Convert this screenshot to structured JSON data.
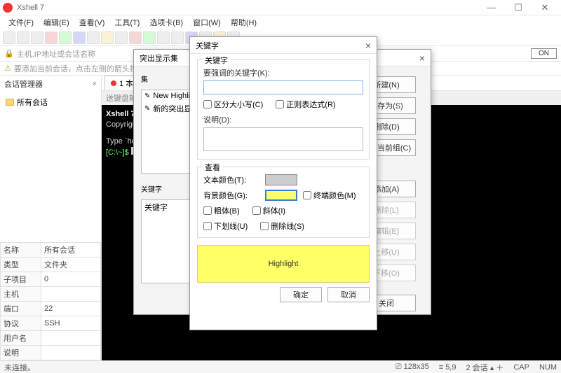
{
  "app": {
    "title": "Xshell 7"
  },
  "menu": [
    "文件(F)",
    "编辑(E)",
    "查看(V)",
    "工具(T)",
    "选项卡(B)",
    "窗口(W)",
    "帮助(H)"
  ],
  "addressbar": {
    "placeholder": "主机,IP地址或会话名称",
    "toggle": "ON"
  },
  "hint": "要添加当前会话，点击左侧的箭头按钮。",
  "session_panel": {
    "title": "会话管理器",
    "root": "所有会话",
    "props": [
      [
        "名称",
        "所有会话"
      ],
      [
        "类型",
        "文件夹"
      ],
      [
        "子项目",
        "0"
      ],
      [
        "主机",
        ""
      ],
      [
        "端口",
        "22"
      ],
      [
        "协议",
        "SSH"
      ],
      [
        "用户名",
        ""
      ],
      [
        "说明",
        ""
      ]
    ]
  },
  "tab": {
    "label": "1 本地"
  },
  "terminal": {
    "banner": "Xshell 7",
    "copyright": "Copyright",
    "typeline": "Type `he",
    "prompt": "[C:\\~]$ "
  },
  "keyboard_hint": "送键盘输入",
  "status": {
    "left": "未连接。",
    "dim": "128x35",
    "pos": "5,9",
    "sessions": "2 会话",
    "cap": "CAP",
    "num": "NUM"
  },
  "dlg_highlight": {
    "title": "突出显示集",
    "group_set": "集",
    "sets": [
      "New Highlight",
      "新的突出显"
    ],
    "group_kw": "关键字",
    "kw_list": "关键字",
    "buttons": {
      "new": "新建(N)",
      "saveas": "另存为(S)",
      "delete": "删除(D)",
      "setcurrent": "置为当前组(C)",
      "add": "添加(A)",
      "remove": "删除(L)",
      "edit": "编辑(E)",
      "up": "上移(U)",
      "down": "下移(O)",
      "close": "关闭"
    }
  },
  "dlg_keyword": {
    "title": "关键字",
    "group_kw": "关键字",
    "label_keyword": "要强调的关键字(K):",
    "keyword_value": "",
    "cb_case": "区分大小写(C)",
    "cb_regex": "正则表达式(R)",
    "label_desc": "说明(D):",
    "desc_value": "",
    "group_view": "查看",
    "label_textcolor": "文本颜色(T):",
    "label_bgcolor": "背景颜色(G):",
    "cb_termcolor": "终端颜色(M)",
    "cb_bold": "粗体(B)",
    "cb_italic": "斜体(I)",
    "cb_underline": "下划线(U)",
    "cb_strike": "删除线(S)",
    "preview": "Highlight",
    "ok": "确定",
    "cancel": "取消"
  }
}
